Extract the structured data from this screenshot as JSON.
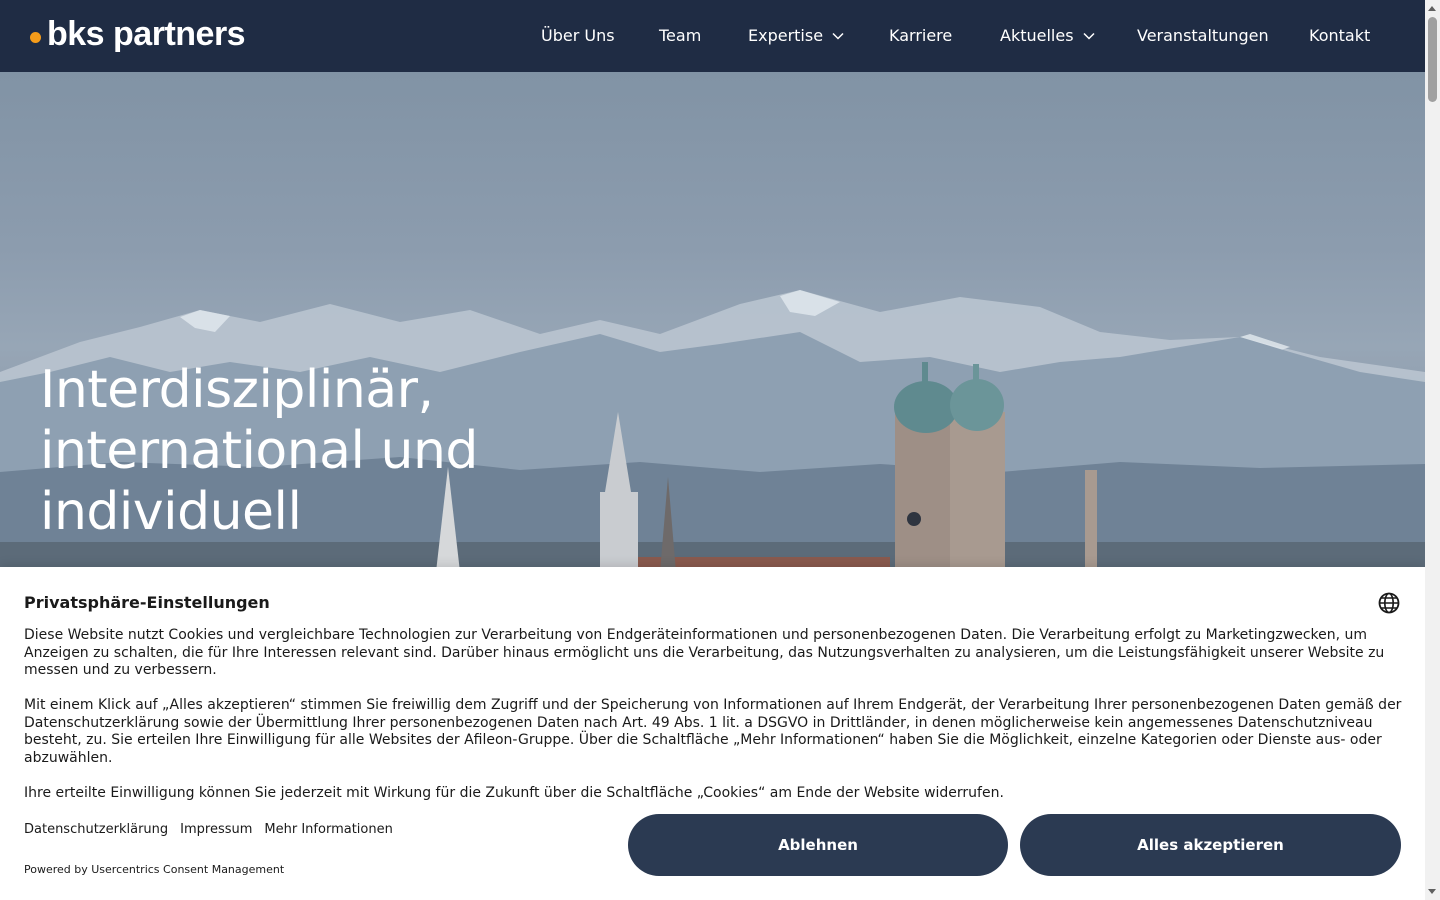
{
  "header": {
    "logo_text": "bks partners",
    "nav": [
      {
        "label": "Über Uns",
        "dropdown": false
      },
      {
        "label": "Team",
        "dropdown": false
      },
      {
        "label": "Expertise",
        "dropdown": true
      },
      {
        "label": "Karriere",
        "dropdown": false
      },
      {
        "label": "Aktuelles",
        "dropdown": true
      },
      {
        "label": "Veranstaltungen",
        "dropdown": false
      },
      {
        "label": "Kontakt",
        "dropdown": false
      }
    ]
  },
  "hero": {
    "title_lines": [
      "Interdisziplinär,",
      "international und",
      "individuell"
    ]
  },
  "consent": {
    "title": "Privatsphäre-Einstellungen",
    "paragraphs": [
      "Diese Website nutzt Cookies und vergleichbare Technologien zur Verarbeitung von Endgeräteinformationen und personenbezogenen Daten. Die Verarbeitung erfolgt zu Marketingzwecken, um Anzeigen zu schalten, die für Ihre Interessen relevant sind. Darüber hinaus ermöglicht uns die Verarbeitung, das Nutzungsverhalten zu analysieren, um die Leistungsfähigkeit unserer Website zu messen und zu verbessern.",
      "Mit einem Klick auf „Alles akzeptieren“ stimmen Sie freiwillig dem Zugriff und der Speicherung von Informationen auf Ihrem Endgerät, der Verarbeitung Ihrer personenbezogenen Daten gemäß der Datenschutzerklärung sowie der Übermittlung Ihrer personenbezogenen Daten nach Art. 49 Abs. 1 lit. a DSGVO in Drittländer, in denen möglicherweise kein angemessenes Datenschutzniveau besteht, zu. Sie erteilen Ihre Einwilligung für alle Websites der Afileon-Gruppe. Über die Schaltfläche „Mehr Informationen“ haben Sie die Möglichkeit, einzelne Kategorien oder Dienste aus- oder abzuwählen.",
      "Ihre erteilte Einwilligung können Sie jederzeit mit Wirkung für die Zukunft über die Schaltfläche „Cookies“ am Ende der Website widerrufen."
    ],
    "links": [
      "Datenschutzerklärung",
      "Impressum",
      "Mehr Informationen"
    ],
    "powered_by": "Powered by Usercentrics Consent Management",
    "deny_label": "Ablehnen",
    "accept_label": "Alles akzeptieren"
  },
  "colors": {
    "nav_bg": "#1f2c44",
    "logo_accent": "#f59c1a",
    "button_bg": "#2b3a52"
  },
  "icons": [
    "chevron-down-icon",
    "globe-icon"
  ]
}
